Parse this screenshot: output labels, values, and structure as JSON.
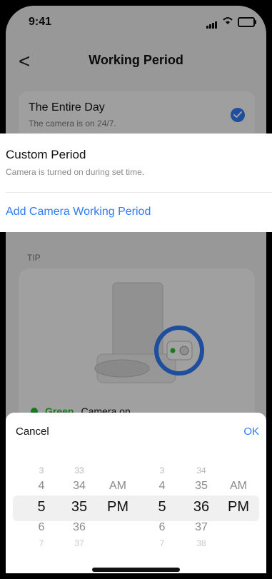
{
  "status_bar": {
    "time": "9:41"
  },
  "nav": {
    "back": "<",
    "title": "Working Period"
  },
  "entire_day": {
    "title": "The Entire Day",
    "subtitle": "The camera is on 24/7."
  },
  "custom": {
    "title": "Custom Period",
    "subtitle": "Camera is turned on during set time."
  },
  "add_period": "Add Camera Working Period",
  "tip": {
    "label": "TIP",
    "legend": {
      "color_word": "Green",
      "meaning": "Camera on"
    }
  },
  "picker": {
    "cancel": "Cancel",
    "ok": "OK",
    "col1": [
      "3",
      "4",
      "5",
      "6",
      "7"
    ],
    "col2": [
      "33",
      "34",
      "35",
      "36",
      "37"
    ],
    "col3": [
      "",
      "AM",
      "PM",
      "",
      ""
    ],
    "col4": [
      "3",
      "4",
      "5",
      "6",
      "7"
    ],
    "col5": [
      "34",
      "35",
      "36",
      "37",
      "38"
    ],
    "col6": [
      "",
      "AM",
      "PM",
      "",
      ""
    ]
  },
  "colors": {
    "accent": "#2f7bf6",
    "status_green": "#27c12b"
  }
}
